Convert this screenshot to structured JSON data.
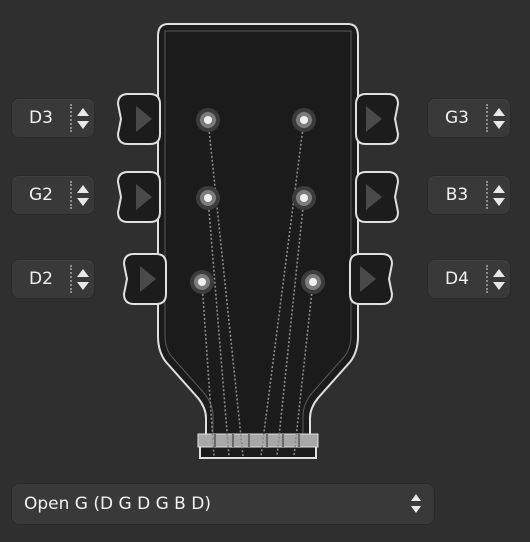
{
  "tuners": {
    "left": [
      {
        "note": "D3",
        "icon": "tuning-peg-icon"
      },
      {
        "note": "G2",
        "icon": "tuning-peg-icon"
      },
      {
        "note": "D2",
        "icon": "tuning-peg-icon"
      }
    ],
    "right": [
      {
        "note": "G3",
        "icon": "tuning-peg-icon"
      },
      {
        "note": "B3",
        "icon": "tuning-peg-icon"
      },
      {
        "note": "D4",
        "icon": "tuning-peg-icon"
      }
    ]
  },
  "tuning": {
    "selected": "Open G (D G D G B D)"
  },
  "colors": {
    "background": "#2f2f2f",
    "headstock_fill": "#1b1b1b",
    "outline": "#e0e0e0",
    "control_bg": "#393939",
    "text": "#f2f2f2"
  }
}
